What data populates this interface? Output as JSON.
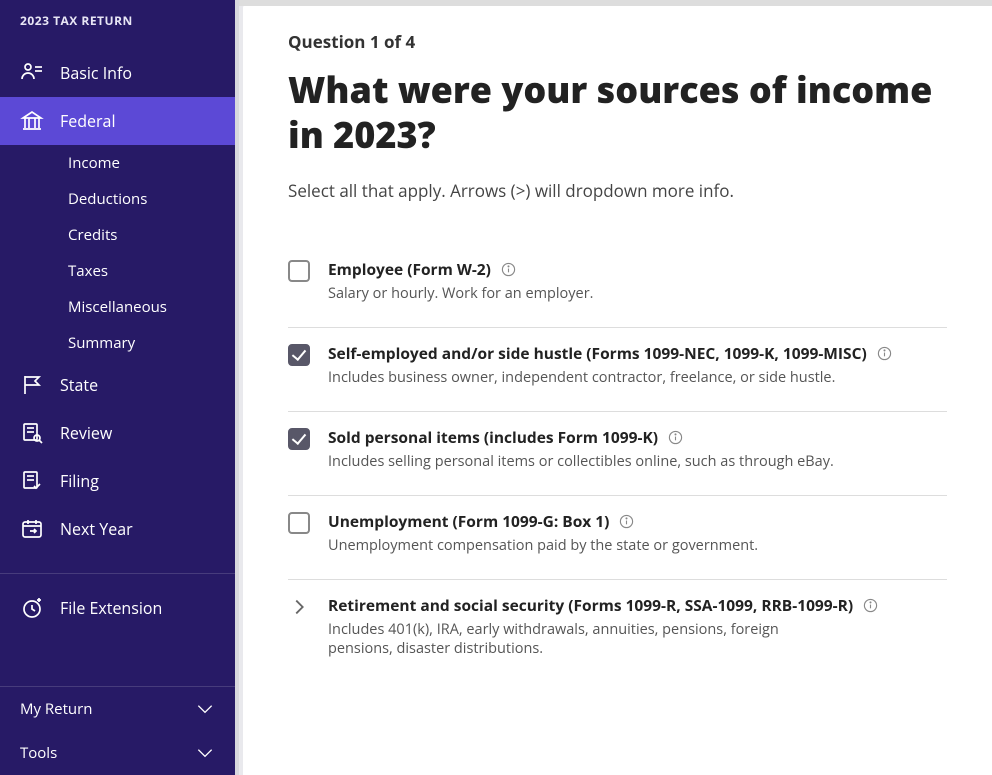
{
  "sidebar": {
    "title": "2023 TAX RETURN",
    "nav": [
      {
        "label": "Basic Info",
        "slug": "basic-info"
      },
      {
        "label": "Federal",
        "slug": "federal",
        "active": true,
        "children": [
          {
            "label": "Income"
          },
          {
            "label": "Deductions"
          },
          {
            "label": "Credits"
          },
          {
            "label": "Taxes"
          },
          {
            "label": "Miscellaneous"
          },
          {
            "label": "Summary"
          }
        ]
      },
      {
        "label": "State",
        "slug": "state"
      },
      {
        "label": "Review",
        "slug": "review"
      },
      {
        "label": "Filing",
        "slug": "filing"
      },
      {
        "label": "Next Year",
        "slug": "next-year"
      }
    ],
    "secondary": [
      {
        "label": "File Extension",
        "slug": "file-extension"
      }
    ],
    "footer": [
      {
        "label": "My Return"
      },
      {
        "label": "Tools"
      }
    ]
  },
  "main": {
    "progress": "Question 1 of 4",
    "title": "What were your sources of income in 2023?",
    "hint": "Select all that apply. Arrows (>) will dropdown more info.",
    "options": [
      {
        "control": "checkbox",
        "checked": false,
        "label": "Employee (Form W-2)",
        "desc": "Salary or hourly. Work for an employer."
      },
      {
        "control": "checkbox",
        "checked": true,
        "label": "Self-employed and/or side hustle (Forms 1099-NEC, 1099-K, 1099-MISC)",
        "desc": "Includes business owner, independent contractor, freelance, or side hustle."
      },
      {
        "control": "checkbox",
        "checked": true,
        "label": "Sold personal items (includes Form 1099-K)",
        "desc": "Includes selling personal items or collectibles online, such as through eBay."
      },
      {
        "control": "checkbox",
        "checked": false,
        "label": "Unemployment (Form 1099-G: Box 1)",
        "desc": "Unemployment compensation paid by the state or government."
      },
      {
        "control": "expander",
        "checked": false,
        "label": "Retirement and social security (Forms 1099-R, SSA-1099, RRB-1099-R)",
        "desc": "Includes 401(k), IRA, early withdrawals, annuities, pensions, foreign pensions, disaster distributions."
      }
    ]
  }
}
